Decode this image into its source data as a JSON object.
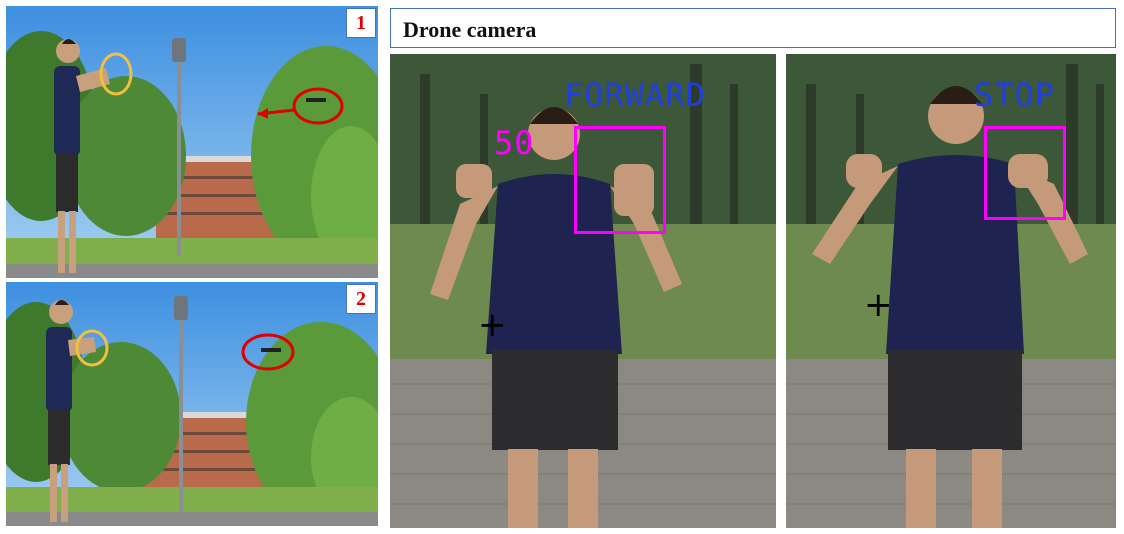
{
  "header": {
    "title": "Drone camera"
  },
  "left_panels": [
    {
      "badge": "1"
    },
    {
      "badge": "2"
    }
  ],
  "drone_frames": [
    {
      "command": "FORWARD",
      "speed": "50",
      "command_color": "#1f3fe0",
      "box_color": "#ff00ff"
    },
    {
      "command": "STOP",
      "command_color": "#1f3fe0",
      "box_color": "#ff00ff"
    }
  ],
  "colors": {
    "badge_border": "#4a70b8",
    "badge_text": "#e00000",
    "hand_circle": "#f0c040",
    "drone_circle": "#e00000"
  }
}
